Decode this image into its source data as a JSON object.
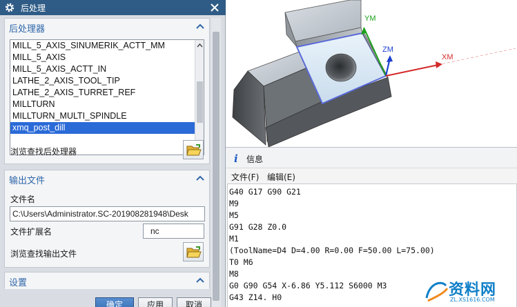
{
  "dialog": {
    "title": "后处理",
    "processor_section": {
      "title": "后处理器",
      "items": [
        "MILL_5_AXIS_SINUMERIK_ACTT_MM",
        "MILL_5_AXIS",
        "MILL_5_AXIS_ACTT_IN",
        "LATHE_2_AXIS_TOOL_TIP",
        "LATHE_2_AXIS_TURRET_REF",
        "MILLTURN",
        "MILLTURN_MULTI_SPINDLE",
        "xmq_post_dill"
      ],
      "selected_index": 7,
      "browse_label": "浏览查找后处理器"
    },
    "output_section": {
      "title": "输出文件",
      "filename_label": "文件名",
      "filename_value": "C:\\Users\\Administrator.SC-201908281948\\Desk",
      "extension_label": "文件扩展名",
      "extension_value": "nc",
      "browse_label": "浏览查找输出文件"
    },
    "settings_section": {
      "title": "设置"
    },
    "buttons": {
      "ok": "确定",
      "apply": "应用",
      "cancel": "取消"
    }
  },
  "viewport": {
    "axes": {
      "ym": "YM",
      "zm": "ZM",
      "xm": "XM"
    },
    "colors": {
      "ym": "#1aa11a",
      "zm": "#1b3fd0",
      "xm": "#d42a2a"
    }
  },
  "info": {
    "title": "信息",
    "menu": {
      "file": "文件(F)",
      "edit": "编辑(E)"
    },
    "lines": [
      "G40 G17 G90 G21",
      "M9",
      "M5",
      "G91 G28 Z0.0",
      "M1",
      "(ToolName=D4 D=4.00 R=0.00 F=50.00 L=75.00)",
      "T0 M6",
      "M8",
      "G0 G90 G54 X-6.86 Y5.112 S6000 M3",
      "G43 Z14. H0"
    ]
  },
  "watermark": {
    "text": "资料网",
    "url": "ZL.XS1616.COM"
  }
}
